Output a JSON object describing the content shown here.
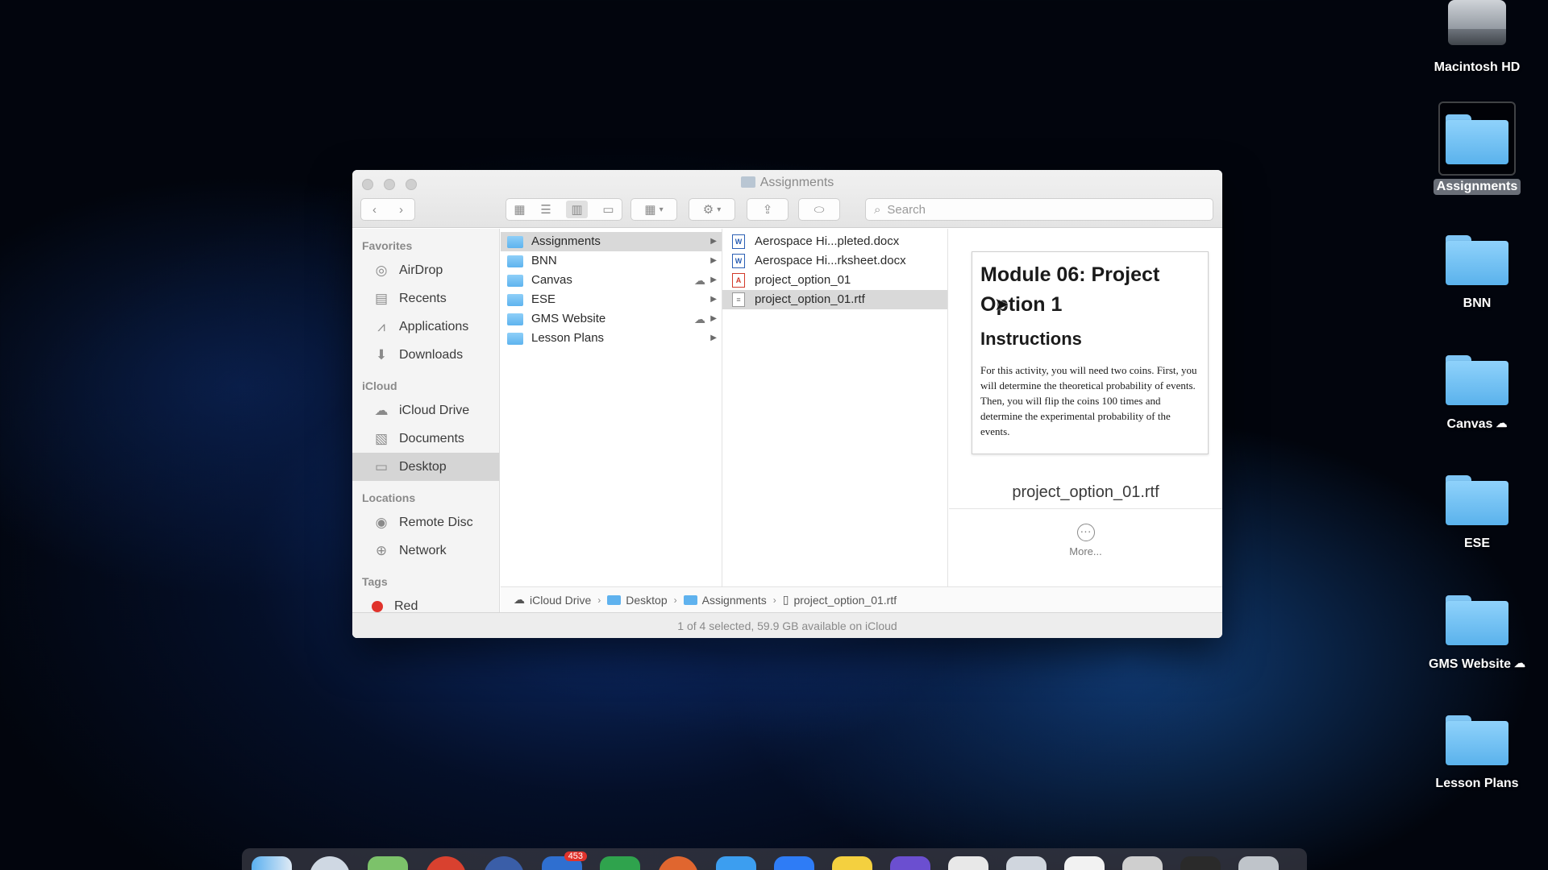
{
  "desktop": {
    "icons": [
      {
        "label": "Macintosh HD"
      },
      {
        "label": "Assignments"
      },
      {
        "label": "BNN"
      },
      {
        "label": "Canvas"
      },
      {
        "label": "ESE"
      },
      {
        "label": "GMS Website"
      },
      {
        "label": "Lesson Plans"
      }
    ]
  },
  "window": {
    "title": "Assignments",
    "search_placeholder": "Search"
  },
  "sidebar": {
    "favorites_header": "Favorites",
    "favorites": [
      {
        "label": "AirDrop",
        "icon": "airdrop-icon"
      },
      {
        "label": "Recents",
        "icon": "clock-icon"
      },
      {
        "label": "Applications",
        "icon": "applications-icon"
      },
      {
        "label": "Downloads",
        "icon": "downloads-icon"
      }
    ],
    "icloud_header": "iCloud",
    "icloud": [
      {
        "label": "iCloud Drive",
        "icon": "cloud-icon"
      },
      {
        "label": "Documents",
        "icon": "documents-icon"
      },
      {
        "label": "Desktop",
        "icon": "desktop-icon",
        "active": true
      }
    ],
    "locations_header": "Locations",
    "locations": [
      {
        "label": "Remote Disc",
        "icon": "disc-icon"
      },
      {
        "label": "Network",
        "icon": "network-icon"
      }
    ],
    "tags_header": "Tags",
    "tags": [
      {
        "label": "Red",
        "color": "#e0332c"
      }
    ]
  },
  "columns": {
    "folders": [
      {
        "name": "Assignments",
        "selected": true
      },
      {
        "name": "BNN"
      },
      {
        "name": "Canvas",
        "cloud": true
      },
      {
        "name": "ESE"
      },
      {
        "name": "GMS Website",
        "cloud": true
      },
      {
        "name": "Lesson Plans"
      }
    ],
    "files": [
      {
        "name": "Aerospace Hi...pleted.docx",
        "type": "word"
      },
      {
        "name": "Aerospace Hi...rksheet.docx",
        "type": "word"
      },
      {
        "name": "project_option_01",
        "type": "pdf"
      },
      {
        "name": "project_option_01.rtf",
        "type": "rtf",
        "selected": true
      }
    ]
  },
  "preview": {
    "doc_title": "Module 06: Project Option 1",
    "doc_heading": "Instructions",
    "doc_body": "For this activity, you will need two coins. First, you will determine the theoretical probability of events. Then, you will flip the coins 100 times and determine the experimental probability of the events.",
    "filename": "project_option_01.rtf",
    "more_label": "More..."
  },
  "pathbar": {
    "items": [
      "iCloud Drive",
      "Desktop",
      "Assignments",
      "project_option_01.rtf"
    ]
  },
  "status": "1 of 4 selected, 59.9 GB available on iCloud",
  "dock": {
    "badge": "453"
  }
}
